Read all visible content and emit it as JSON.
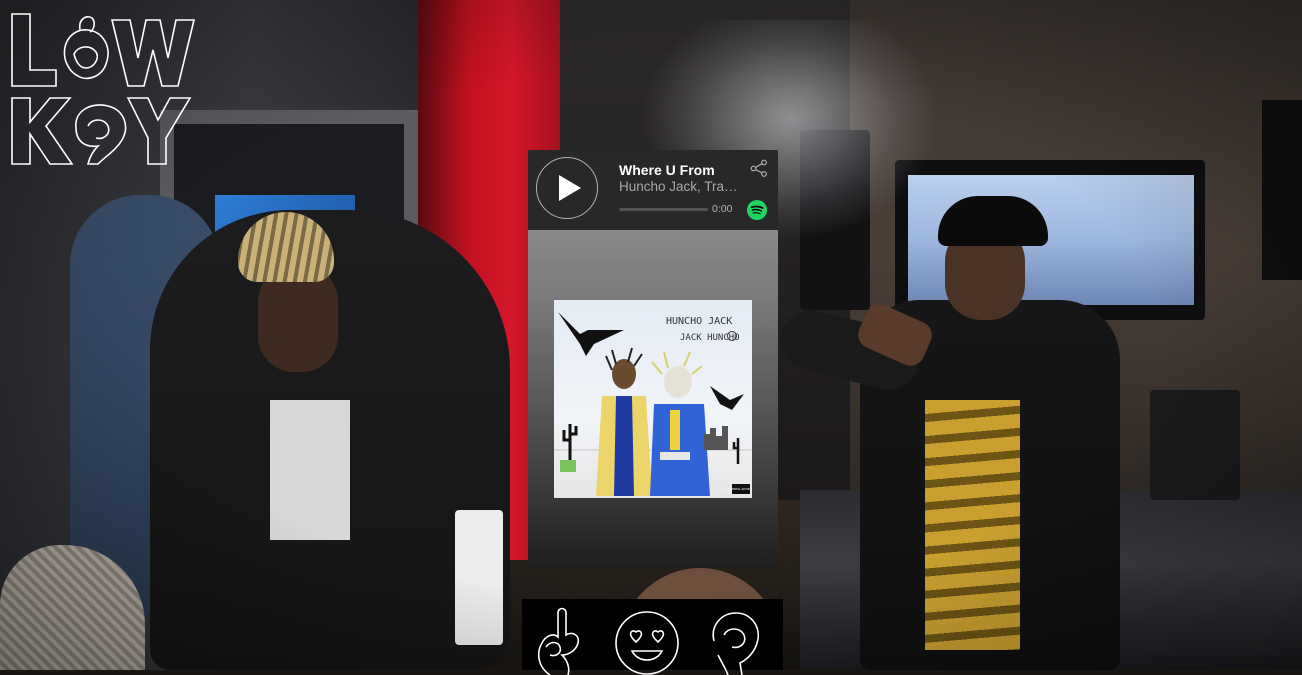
{
  "brand": {
    "logo_text": "LOW KEY"
  },
  "player": {
    "track_title": "Where U From",
    "artist": "Huncho Jack, Travis Scott, Quavo",
    "time": "0:00",
    "progress": 0,
    "accent_color": "#1ed760"
  },
  "album": {
    "cover_text": "HUNCHO JACK JACK HUNCHO",
    "advisory_label": "PARENTAL ADVISORY"
  },
  "reactions": [
    {
      "icon": "ok-hand-icon"
    },
    {
      "icon": "heart-eyes-icon"
    },
    {
      "icon": "hand-gesture-icon"
    }
  ]
}
